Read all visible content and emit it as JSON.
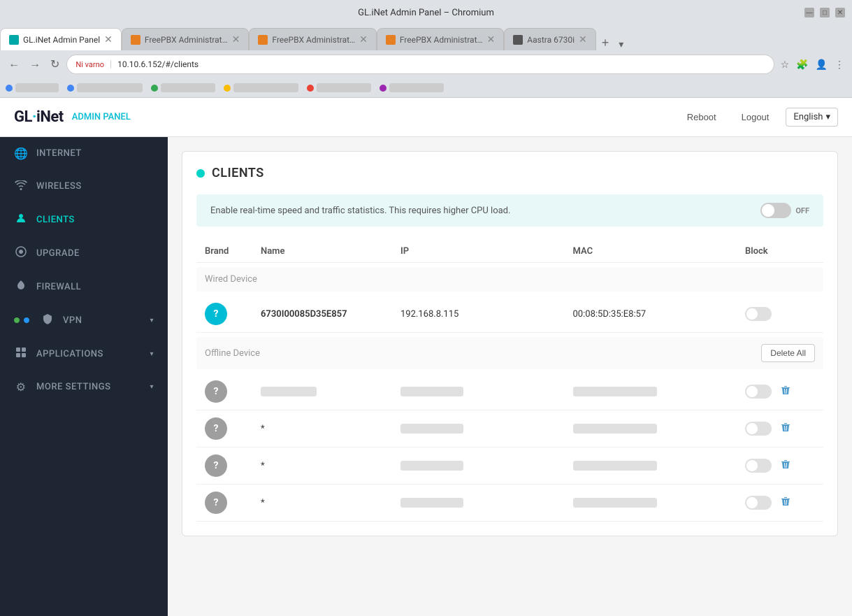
{
  "browser": {
    "title": "GL.iNet Admin Panel – Chromium",
    "tabs": [
      {
        "label": "GL.iNet Admin Panel",
        "type": "glinet",
        "active": true
      },
      {
        "label": "FreePBX Administrat…",
        "type": "freepbx",
        "active": false
      },
      {
        "label": "FreePBX Administrat…",
        "type": "freepbx",
        "active": false
      },
      {
        "label": "FreePBX Administrat…",
        "type": "freepbx",
        "active": false
      },
      {
        "label": "Aastra 6730i",
        "type": "aastra",
        "active": false
      }
    ],
    "address": "10.10.6.152/#/clients",
    "secure_label": "Ni varno",
    "address_full": "10.10.6.152/#/clients"
  },
  "header": {
    "logo": "GL·iNet",
    "logo_dot": "·",
    "admin_panel": "ADMIN PANEL",
    "reboot": "Reboot",
    "logout": "Logout",
    "language": "English",
    "language_arrow": "▾"
  },
  "sidebar": {
    "items": [
      {
        "id": "internet",
        "label": "INTERNET",
        "icon": "🌐"
      },
      {
        "id": "wireless",
        "label": "WIRELESS",
        "icon": "📶"
      },
      {
        "id": "clients",
        "label": "CLIENTS",
        "icon": "👤",
        "active": true
      },
      {
        "id": "upgrade",
        "label": "UPGRADE",
        "icon": "⚙"
      },
      {
        "id": "firewall",
        "label": "FIREWALL",
        "icon": "🔥"
      },
      {
        "id": "vpn",
        "label": "VPN",
        "icon": "🛡",
        "has_arrow": true,
        "has_dots": true
      },
      {
        "id": "applications",
        "label": "APPLICATIONS",
        "icon": "⊞",
        "has_arrow": true
      },
      {
        "id": "more_settings",
        "label": "MORE SETTINGS",
        "icon": "⚙",
        "has_arrow": true
      }
    ]
  },
  "main": {
    "page_title": "CLIENTS",
    "stats_banner": "Enable real-time speed and traffic statistics. This requires higher CPU load.",
    "toggle_state": "OFF",
    "table": {
      "columns": [
        "Brand",
        "Name",
        "IP",
        "MAC",
        "Block"
      ],
      "wired_section": "Wired Device",
      "wired_devices": [
        {
          "name": "6730I00085D35E857",
          "ip": "192.168.8.115",
          "mac": "00:08:5D:35:E8:57",
          "blocked": false,
          "online": true
        }
      ],
      "offline_section": "Offline Device",
      "delete_all": "Delete All",
      "offline_devices": [
        {
          "name": "██████",
          "ip": "█████████",
          "mac": "████████████",
          "blocked": false
        },
        {
          "name": "*",
          "ip": "█████████",
          "mac": "████████████",
          "blocked": false
        },
        {
          "name": "*",
          "ip": "█████████",
          "mac": "████████████",
          "blocked": false
        },
        {
          "name": "*",
          "ip": "█████████",
          "mac": "████████████",
          "blocked": false
        }
      ]
    }
  },
  "bookmarks": [
    {
      "label": "████████"
    },
    {
      "label": "████████████"
    },
    {
      "label": "██████████"
    },
    {
      "label": "████████████"
    },
    {
      "label": "██████████"
    },
    {
      "label": "██████████"
    },
    {
      "label": "████████████"
    }
  ]
}
